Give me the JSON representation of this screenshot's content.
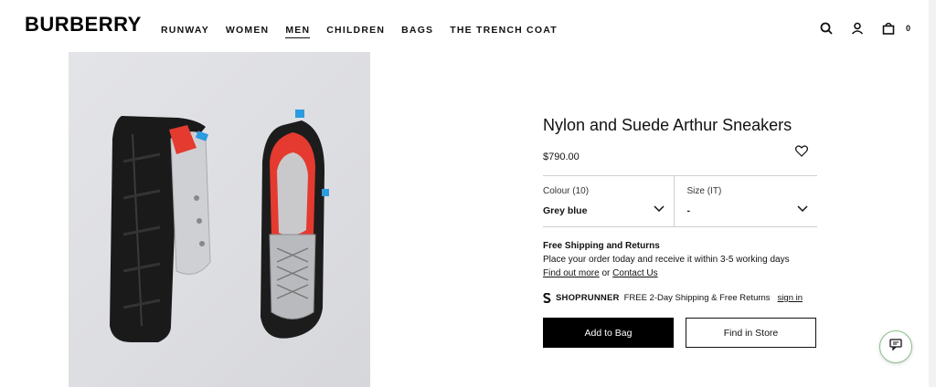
{
  "brand": {
    "logo_text": "BURBERRY"
  },
  "nav": {
    "items": [
      {
        "label": "RUNWAY"
      },
      {
        "label": "WOMEN"
      },
      {
        "label": "MEN",
        "active": true
      },
      {
        "label": "CHILDREN"
      },
      {
        "label": "BAGS"
      },
      {
        "label": "THE TRENCH COAT"
      }
    ]
  },
  "header": {
    "icons": [
      "search-icon",
      "account-icon",
      "bag-icon"
    ],
    "bag_count": "0"
  },
  "product": {
    "title": "Nylon and Suede Arthur Sneakers",
    "price": "$790.00",
    "colour": {
      "label": "Colour (10)",
      "value": "Grey blue"
    },
    "size": {
      "label": "Size (IT)",
      "value": "-"
    },
    "shipping": {
      "title": "Free Shipping and Returns",
      "text": "Place your order today and receive it within 3-5 working days",
      "find_out_more": "Find out more",
      "or": "or",
      "contact_us": "Contact Us"
    },
    "shoprunner": {
      "brand": "SHOPRUNNER",
      "text": "FREE 2-Day Shipping & Free Returns",
      "link": "sign in"
    },
    "add_to_bag": "Add to Bag",
    "find_in_store": "Find in Store"
  },
  "colors": {
    "primary": "#000000",
    "background": "#ffffff",
    "accent_red": "#e43a2f",
    "accent_blue": "#2c9be0"
  }
}
